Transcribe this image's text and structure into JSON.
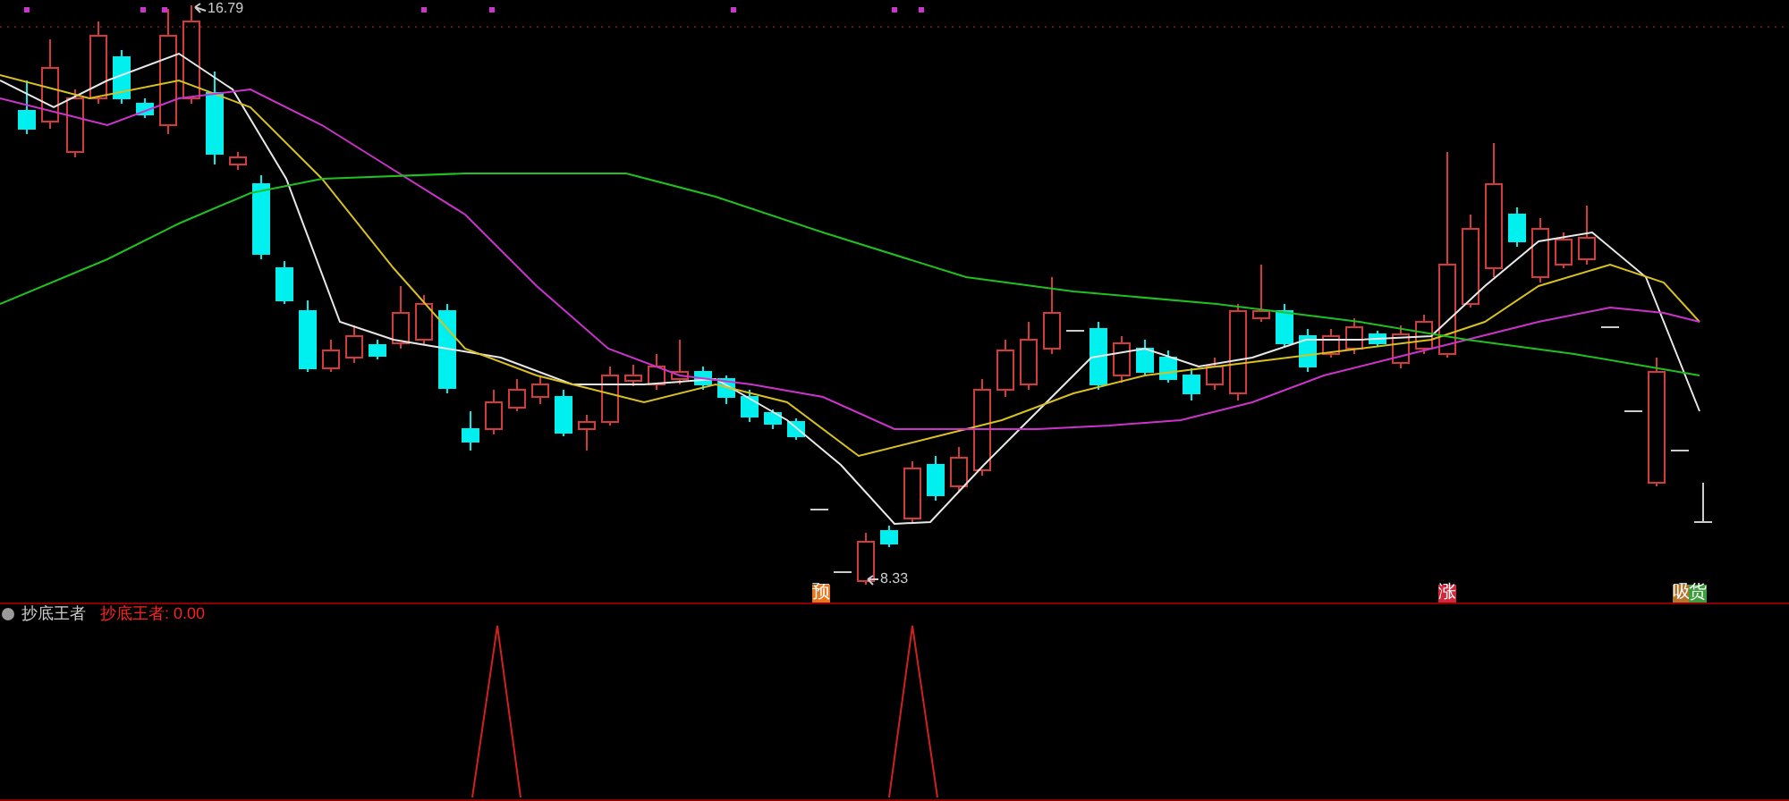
{
  "main_chart": {
    "high_label": "16.79",
    "low_label": "8.33",
    "signals": [
      {
        "text": "预",
        "color": "#e8761e"
      },
      {
        "text": "涨",
        "color": "#d0283a"
      },
      {
        "text": "吸",
        "color": "#b5742a"
      },
      {
        "text": "货",
        "color": "#3c9d3c"
      }
    ]
  },
  "indicator_panel": {
    "title": "抄底王者",
    "value_label": "抄底王者: 0.00"
  }
}
